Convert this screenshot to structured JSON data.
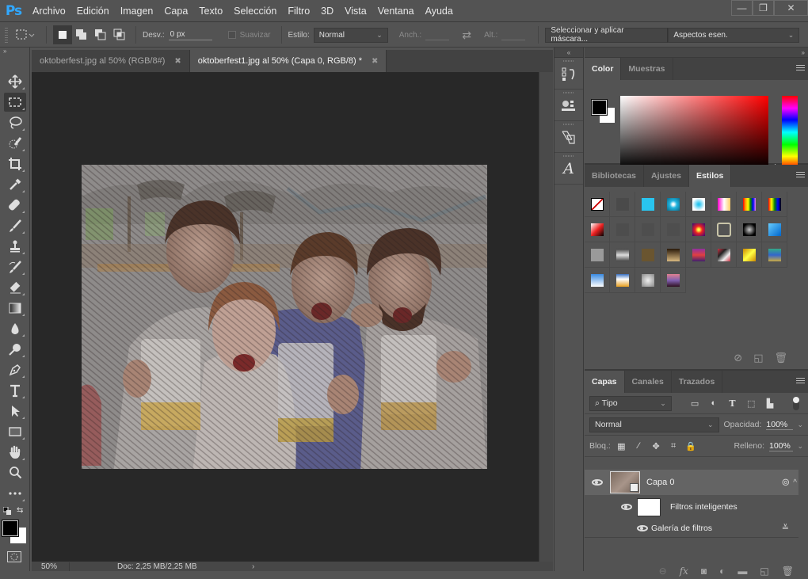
{
  "app": {
    "logo": "Ps"
  },
  "menu": [
    "Archivo",
    "Edición",
    "Imagen",
    "Capa",
    "Texto",
    "Selección",
    "Filtro",
    "3D",
    "Vista",
    "Ventana",
    "Ayuda"
  ],
  "window_controls": {
    "minimize": "—",
    "restore": "❐",
    "close": "✕"
  },
  "options_bar": {
    "feather_label": "Desv.:",
    "feather_value": "0 px",
    "antialias_label": "Suavizar",
    "style_label": "Estilo:",
    "style_value": "Normal",
    "width_label": "Anch.:",
    "height_label": "Alt.:",
    "select_mask_button": "Seleccionar y aplicar máscara...",
    "workspace_value": "Aspectos esen."
  },
  "documents": [
    {
      "title": "oktoberfest.jpg al 50% (RGB/8#)",
      "active": false
    },
    {
      "title": "oktoberfest1.jpg al 50% (Capa 0, RGB/8) *",
      "active": true
    }
  ],
  "status": {
    "zoom": "50%",
    "doc_info": "Doc: 2,25 MB/2,25 MB"
  },
  "tools": [
    "move",
    "rectangular-marquee",
    "lasso",
    "quick-selection",
    "crop",
    "eyedropper",
    "healing-brush",
    "brush",
    "clone-stamp",
    "history-brush",
    "eraser",
    "gradient",
    "blur",
    "dodge",
    "pen",
    "type",
    "path-selection",
    "rectangle",
    "hand",
    "zoom",
    "more-tools"
  ],
  "colors": {
    "foreground": "#000000",
    "background": "#ffffff",
    "accent": "#31a8ff"
  },
  "color_panel": {
    "tabs": [
      "Color",
      "Muestras"
    ],
    "active": "Color"
  },
  "styles_panel": {
    "tabs": [
      "Bibliotecas",
      "Ajustes",
      "Estilos"
    ],
    "active": "Estilos",
    "swatch_count": 28
  },
  "layers_panel": {
    "tabs": [
      "Capas",
      "Canales",
      "Trazados"
    ],
    "active": "Capas",
    "filter_kind": "Tipo",
    "blend_mode": "Normal",
    "opacity_label": "Opacidad:",
    "opacity_value": "100%",
    "lock_label": "Bloq.:",
    "fill_label": "Relleno:",
    "fill_value": "100%",
    "layers": [
      {
        "name": "Capa 0",
        "visible": true,
        "smart_object": true
      },
      {
        "name": "Filtros inteligentes",
        "visible": true
      },
      {
        "name": "Galería de filtros",
        "visible": true
      }
    ]
  }
}
